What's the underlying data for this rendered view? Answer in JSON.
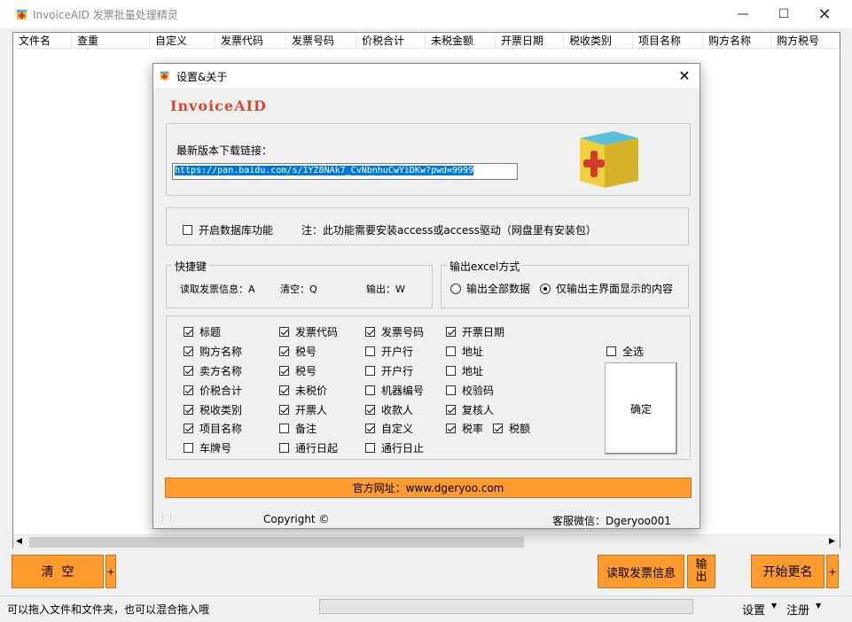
{
  "window": {
    "title": "InvoiceAID 发票批量处理精灵"
  },
  "columns": [
    "文件名",
    "查重",
    "自定义",
    "发票代码",
    "发票号码",
    "价税合计",
    "未税金额",
    "开票日期",
    "税收类别",
    "项目名称",
    "购方名称",
    "购方税号"
  ],
  "buttons": {
    "clear": "清  空",
    "plus": "+",
    "read_info": "读取发票信息",
    "export": "输出",
    "rename": "开始更名"
  },
  "status": {
    "hint": "可以拖入文件和文件夹，也可以混合拖入哦",
    "settings": "设置",
    "register": "注册"
  },
  "dialog": {
    "title": "设置&关于",
    "brand": "InvoiceAID",
    "download_label": "最新版本下载链接：",
    "download_url": "https://pan.baidu.com/s/1YZ8NAk7_CvNbnhuCwYiDKw?pwd=9999",
    "db_option": "开启数据库功能",
    "db_checked": false,
    "db_note": "注：此功能需要安装access或access驱动（网盘里有安装包）",
    "shortcut_title": "快捷键",
    "shortcut_read": "读取发票信息：A",
    "shortcut_clear": "清空：Q",
    "shortcut_export": "输出：W",
    "excel_title": "输出excel方式",
    "excel_all": "输出全部数据",
    "excel_visible": "仅输出主界面显示的内容",
    "excel_selected": "visible",
    "select_all": "全选",
    "confirm": "确定",
    "website": "官方网址：www.dgeryoo.com",
    "copyright": "Copyright ©",
    "wechat": "客服微信：Dgeryoo001",
    "fields": [
      {
        "label": "标题",
        "checked": true
      },
      {
        "label": "购方名称",
        "checked": true
      },
      {
        "label": "卖方名称",
        "checked": true
      },
      {
        "label": "价税合计",
        "checked": true
      },
      {
        "label": "税收类别",
        "checked": true
      },
      {
        "label": "项目名称",
        "checked": true
      },
      {
        "label": "车牌号",
        "checked": false
      },
      {
        "label": "发票代码",
        "checked": true
      },
      {
        "label": "税号",
        "checked": true
      },
      {
        "label": "税号",
        "checked": true
      },
      {
        "label": "未税价",
        "checked": true
      },
      {
        "label": "开票人",
        "checked": true
      },
      {
        "label": "备注",
        "checked": false
      },
      {
        "label": "通行日起",
        "checked": false
      },
      {
        "label": "发票号码",
        "checked": true
      },
      {
        "label": "开户行",
        "checked": false
      },
      {
        "label": "开户行",
        "checked": false
      },
      {
        "label": "机器编号",
        "checked": false
      },
      {
        "label": "收款人",
        "checked": true
      },
      {
        "label": "自定义",
        "checked": true
      },
      {
        "label": "通行日止",
        "checked": false
      },
      {
        "label": "开票日期",
        "checked": true
      },
      {
        "label": "地址",
        "checked": false
      },
      {
        "label": "地址",
        "checked": false
      },
      {
        "label": "校验码",
        "checked": false
      },
      {
        "label": "复核人",
        "checked": true
      },
      {
        "label": "税率",
        "checked": true
      },
      {
        "label": "税额",
        "checked": true
      }
    ]
  }
}
